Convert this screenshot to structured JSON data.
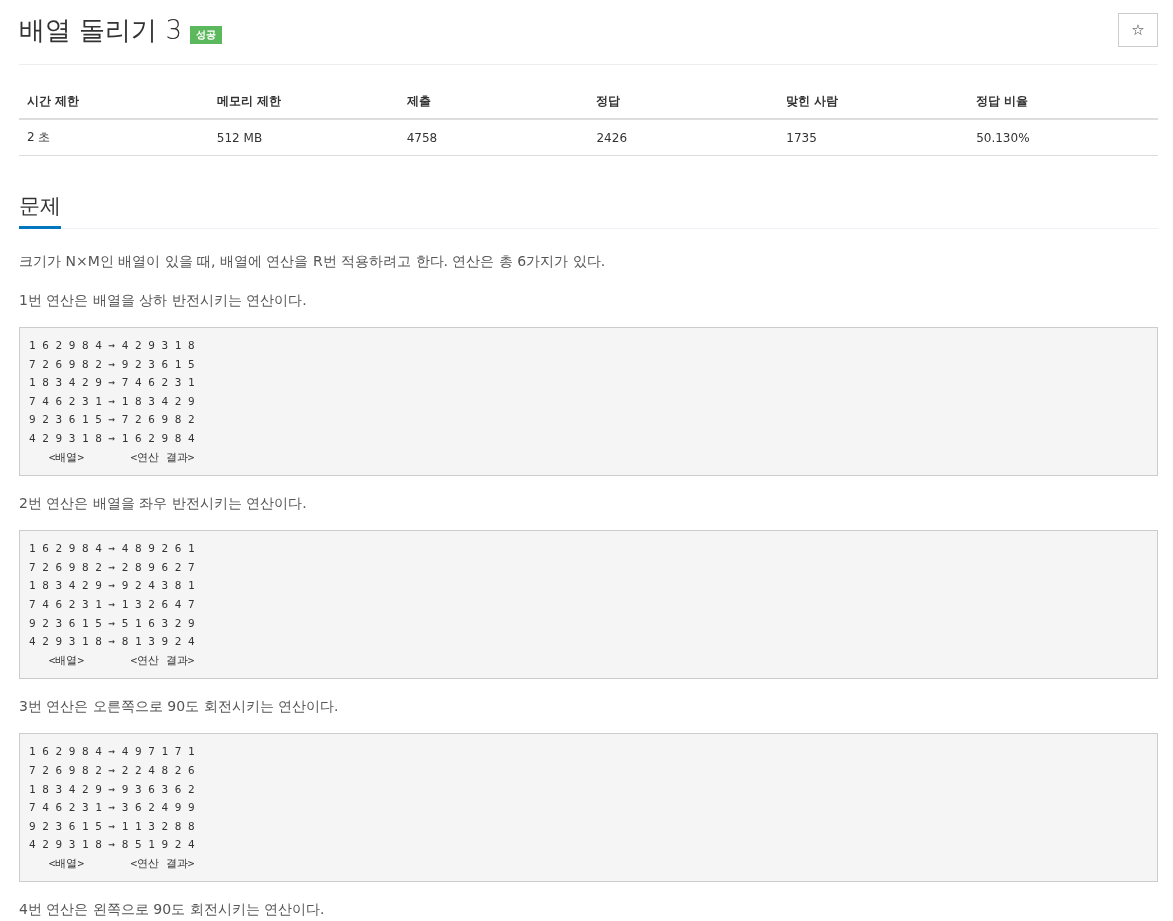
{
  "title": "배열 돌리기 3",
  "badge": "성공",
  "star_button": "☆",
  "info_table": {
    "columns": [
      "시간 제한",
      "메모리 제한",
      "제출",
      "정답",
      "맞힌 사람",
      "정답 비율"
    ],
    "rows": [
      [
        "2 초",
        "512 MB",
        "4758",
        "2426",
        "1735",
        "50.130%"
      ]
    ]
  },
  "section": {
    "heading": "문제",
    "blocks": [
      {
        "kind": "paragraph",
        "text": "크기가 N×M인 배열이 있을 때, 배열에 연산을 R번 적용하려고 한다. 연산은 총 6가지가 있다."
      },
      {
        "kind": "paragraph",
        "text": "1번 연산은 배열을 상하 반전시키는 연산이다."
      },
      {
        "kind": "code",
        "lines": [
          "1 6 2 9 8 4 → 4 2 9 3 1 8",
          "7 2 6 9 8 2 → 9 2 3 6 1 5",
          "1 8 3 4 2 9 → 7 4 6 2 3 1",
          "7 4 6 2 3 1 → 1 8 3 4 2 9",
          "9 2 3 6 1 5 → 7 2 6 9 8 2",
          "4 2 9 3 1 8 → 1 6 2 9 8 4",
          "   <배열>       <연산 결과>"
        ]
      },
      {
        "kind": "paragraph",
        "text": "2번 연산은 배열을 좌우 반전시키는 연산이다."
      },
      {
        "kind": "code",
        "lines": [
          "1 6 2 9 8 4 → 4 8 9 2 6 1",
          "7 2 6 9 8 2 → 2 8 9 6 2 7",
          "1 8 3 4 2 9 → 9 2 4 3 8 1",
          "7 4 6 2 3 1 → 1 3 2 6 4 7",
          "9 2 3 6 1 5 → 5 1 6 3 2 9",
          "4 2 9 3 1 8 → 8 1 3 9 2 4",
          "   <배열>       <연산 결과>"
        ]
      },
      {
        "kind": "paragraph",
        "text": "3번 연산은 오른쪽으로 90도 회전시키는 연산이다."
      },
      {
        "kind": "code",
        "lines": [
          "1 6 2 9 8 4 → 4 9 7 1 7 1",
          "7 2 6 9 8 2 → 2 2 4 8 2 6",
          "1 8 3 4 2 9 → 9 3 6 3 6 2",
          "7 4 6 2 3 1 → 3 6 2 4 9 9",
          "9 2 3 6 1 5 → 1 1 3 2 8 8",
          "4 2 9 3 1 8 → 8 5 1 9 2 4",
          "   <배열>       <연산 결과>"
        ]
      },
      {
        "kind": "paragraph",
        "text": "4번 연산은 왼쪽으로 90도 회전시키는 연산이다."
      }
    ]
  }
}
